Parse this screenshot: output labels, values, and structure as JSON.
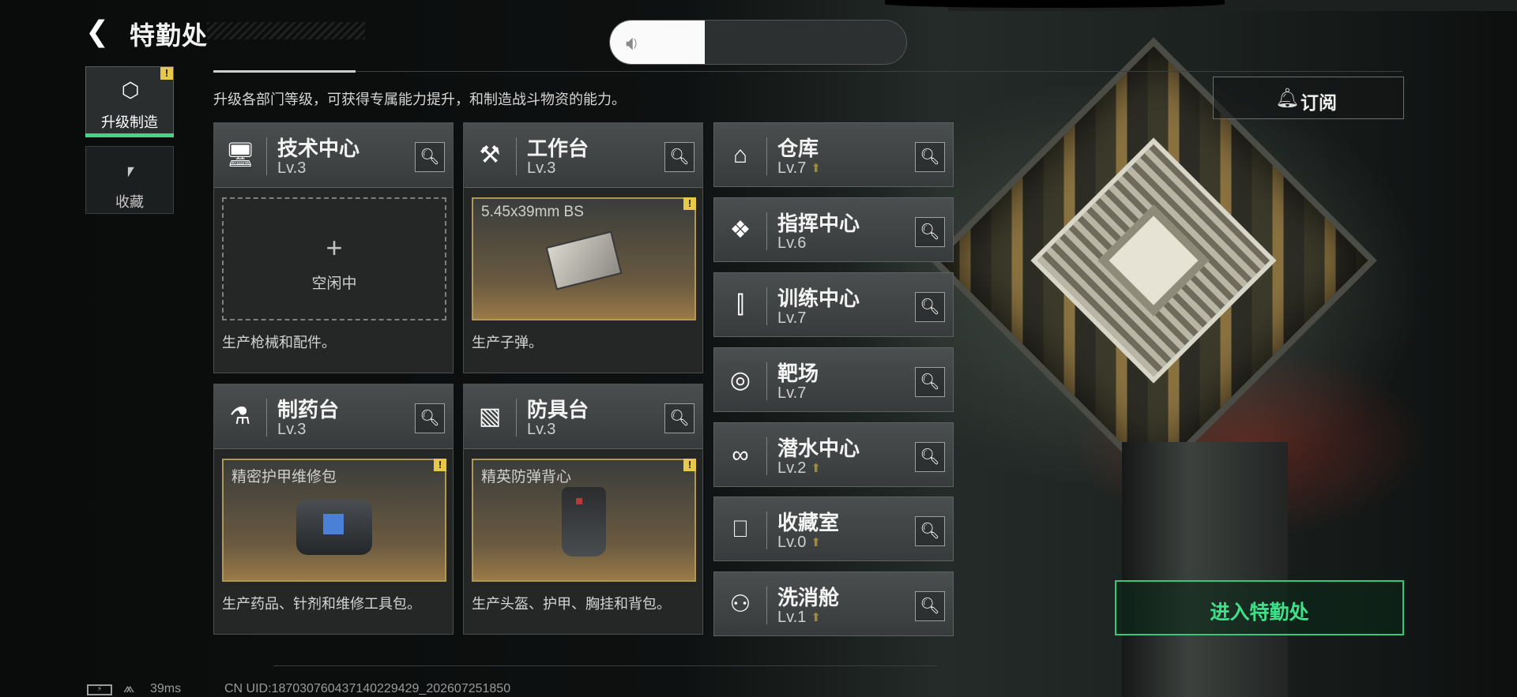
{
  "header": {
    "title": "特勤处",
    "back_icon": "back-arrow-icon"
  },
  "volume": {
    "icon": "speaker-icon",
    "level": 0.32
  },
  "tabs": [
    {
      "label": "升级制造",
      "icon": "upgrade-craft-icon",
      "active": true,
      "alert": "!"
    },
    {
      "label": "收藏",
      "icon": "collection-icon",
      "active": false
    }
  ],
  "subtitle": "升级各部门等级，可获得专属能力提升，和制造战斗物资的能力。",
  "subscribe": {
    "label": "订阅",
    "icon": "bell-icon"
  },
  "production_cards": [
    {
      "name": "技术中心",
      "level": "Lv.3",
      "icon": "tech-center-icon",
      "slot_state": "empty",
      "plus": "+",
      "idle_text": "空闲中",
      "desc": "生产枪械和配件。"
    },
    {
      "name": "工作台",
      "level": "Lv.3",
      "icon": "workbench-icon",
      "slot_state": "item",
      "item_name": "5.45x39mm BS",
      "alert": "!",
      "desc": "生产子弹。"
    },
    {
      "name": "制药台",
      "level": "Lv.3",
      "icon": "pharmacy-icon",
      "slot_state": "item",
      "item_name": "精密护甲维修包",
      "alert": "!",
      "desc": "生产药品、针剂和维修工具包。"
    },
    {
      "name": "防具台",
      "level": "Lv.3",
      "icon": "armor-bench-icon",
      "slot_state": "item",
      "item_name": "精英防弹背心",
      "alert": "!",
      "desc": "生产头盔、护甲、胸挂和背包。"
    }
  ],
  "facilities": [
    {
      "name": "仓库",
      "level": "Lv.7",
      "icon": "warehouse-icon",
      "upgradable": true
    },
    {
      "name": "指挥中心",
      "level": "Lv.6",
      "icon": "command-center-icon",
      "upgradable": false
    },
    {
      "name": "训练中心",
      "level": "Lv.7",
      "icon": "training-center-icon",
      "upgradable": false
    },
    {
      "name": "靶场",
      "level": "Lv.7",
      "icon": "shooting-range-icon",
      "upgradable": false
    },
    {
      "name": "潜水中心",
      "level": "Lv.2",
      "icon": "diving-center-icon",
      "upgradable": true
    },
    {
      "name": "收藏室",
      "level": "Lv.0",
      "icon": "collection-room-icon",
      "upgradable": true
    },
    {
      "name": "洗消舱",
      "level": "Lv.1",
      "icon": "decon-chamber-icon",
      "upgradable": true
    }
  ],
  "search_icon": "search-icon",
  "enter_button": {
    "label": "进入特勤处"
  },
  "status_bar": {
    "ping": "39ms",
    "uid": "CN UID:18703076043714022942​9_202607251850"
  }
}
